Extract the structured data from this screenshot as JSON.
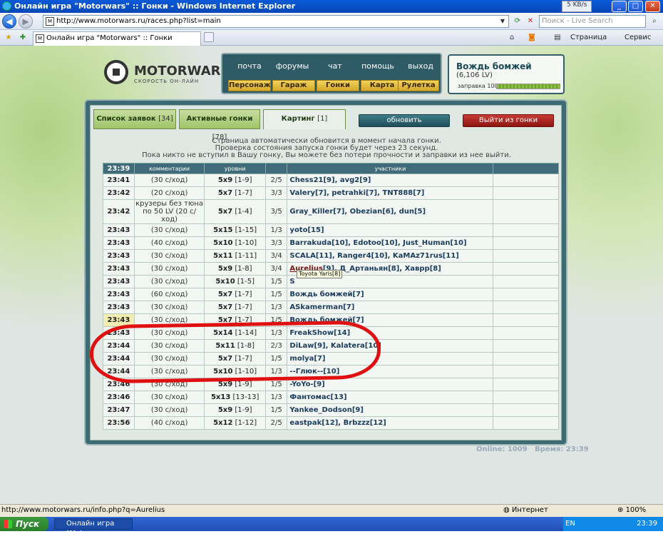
{
  "window": {
    "title": "Онлайн игра \"Motorwars\" :: Гонки - Windows Internet Explorer",
    "netspeed": "5 KB/s"
  },
  "browser": {
    "url": "http://www.motorwars.ru/races.php?list=main",
    "search_placeholder": "Поиск - Live Search",
    "tab_title": "Онлайн игра \"Motorwars\" :: Гонки",
    "page_menu": "Страница",
    "tools_menu": "Сервис"
  },
  "site": {
    "logo_name": "MOTORWARS.RU",
    "logo_sub": "СКОРОСТЬ ОН-ЛАЙН",
    "nav_top": [
      "почта",
      "форумы",
      "чат",
      "помощь",
      "выход"
    ],
    "nav_bottom": [
      "Персонаж",
      "Гараж",
      "Гонки",
      "Карта",
      "Рулетка"
    ]
  },
  "user": {
    "name": "Вождь бомжей",
    "lv": "(6,106 LV)",
    "fuel_label": "заправка 100%",
    "fuel_fraction": 1.0
  },
  "tabs": [
    {
      "label": "Список заявок",
      "count": "[34]"
    },
    {
      "label": "Активные гонки",
      "count": "[78]"
    },
    {
      "label": "Картинг",
      "count": "[1]"
    }
  ],
  "buttons": {
    "refresh": "обновить",
    "leave": "Выйти из гонки"
  },
  "notice": [
    "Страница автоматически обновится в момент начала гонки.",
    "Проверка состояния запуска гонки будет через 23 секунд.",
    "Пока никто не вступил в Вашу гонку, Вы можете без потери прочности и заправки из нее выйти."
  ],
  "table": {
    "time": "23:39",
    "col_comment": "комментарии",
    "col_levels": "уровни",
    "col_participants": "участники",
    "rows": [
      {
        "time": "23:41",
        "comment": "(30 с/ход)",
        "size": "5x9",
        "range": "[1-9]",
        "slots": "2/5",
        "participants": "Chess21[9], avg2[9]"
      },
      {
        "time": "23:42",
        "comment": "(20 с/ход)",
        "size": "5x7",
        "range": "[1-7]",
        "slots": "3/3",
        "participants": "Valery[7], petrahki[7], TNT888[7]"
      },
      {
        "time": "23:42",
        "comment": "крузеры без тюна по 50 LV (20 с/ход)",
        "size": "5x7",
        "range": "[1-4]",
        "slots": "3/5",
        "participants": "Gray_Killer[7], Obezian[6], dun[5]"
      },
      {
        "time": "23:43",
        "comment": "(30 с/ход)",
        "size": "5x15",
        "range": "[1-15]",
        "slots": "1/3",
        "participants": "yoto[15]"
      },
      {
        "time": "23:43",
        "comment": "(40 с/ход)",
        "size": "5x10",
        "range": "[1-10]",
        "slots": "3/3",
        "participants": "Barrakuda[10], Edotoo[10], Just_Human[10]"
      },
      {
        "time": "23:43",
        "comment": "(30 с/ход)",
        "size": "5x11",
        "range": "[1-11]",
        "slots": "3/4",
        "participants": "SCALA[11], Ranger4[10], KaMAz71rus[11]"
      },
      {
        "time": "23:43",
        "comment": "(30 с/ход)",
        "size": "5x9",
        "range": "[1-8]",
        "slots": "3/4",
        "lead": "Aurelius",
        "participants": "[9], Д_Артаньян[8], Хаврр[8]"
      },
      {
        "time": "23:43",
        "comment": "(30 с/ход)",
        "size": "5x10",
        "range": "[1-5]",
        "slots": "1/5",
        "participants": "S"
      },
      {
        "time": "23:43",
        "comment": "(60 с/ход)",
        "size": "5x7",
        "range": "[1-7]",
        "slots": "1/5",
        "participants": "Вождь бомжей[7]"
      },
      {
        "time": "23:43",
        "comment": "(30 с/ход)",
        "size": "5x7",
        "range": "[1-7]",
        "slots": "1/3",
        "participants": "ASkamerman[7]"
      },
      {
        "time": "23:43",
        "comment": "(30 с/ход)",
        "size": "5x7",
        "range": "[1-7]",
        "slots": "1/5",
        "participants": "Вождь бомжей[7]",
        "highlight": true
      },
      {
        "time": "23:43",
        "comment": "(30 с/ход)",
        "size": "5x14",
        "range": "[1-14]",
        "slots": "1/3",
        "participants": "FreakShow[14]"
      },
      {
        "time": "23:44",
        "comment": "(30 с/ход)",
        "size": "5x11",
        "range": "[1-8]",
        "slots": "2/3",
        "participants": "DiLaw[9], Kalatera[10]"
      },
      {
        "time": "23:44",
        "comment": "(30 с/ход)",
        "size": "5x7",
        "range": "[1-7]",
        "slots": "1/5",
        "participants": "molya[7]"
      },
      {
        "time": "23:44",
        "comment": "(30 с/ход)",
        "size": "5x10",
        "range": "[1-10]",
        "slots": "1/3",
        "participants": "--Глюк--[10]"
      },
      {
        "time": "23:46",
        "comment": "(30 с/ход)",
        "size": "5x9",
        "range": "[1-9]",
        "slots": "1/5",
        "participants": "-YoYo-[9]"
      },
      {
        "time": "23:46",
        "comment": "(30 с/ход)",
        "size": "5x13",
        "range": "[13-13]",
        "slots": "1/3",
        "participants": "Фантомас[13]"
      },
      {
        "time": "23:47",
        "comment": "(30 с/ход)",
        "size": "5x9",
        "range": "[1-9]",
        "slots": "1/5",
        "participants": "Yankee_Dodson[9]"
      },
      {
        "time": "23:56",
        "comment": "(40 с/ход)",
        "size": "5x12",
        "range": "[1-12]",
        "slots": "2/5",
        "participants": "eastpak[12], Brbzzz[12]"
      }
    ]
  },
  "tooltip": "Toyota Yaris[8]",
  "footer": {
    "online": "Online: 1009",
    "time": "Время: 23:39"
  },
  "status": {
    "link": "http://www.motorwars.ru/info.php?q=Aurelius",
    "zone": "Интернет",
    "zoom": "100%"
  },
  "taskbar": {
    "start": "Пуск",
    "task": "Онлайн игра \"Motor...",
    "lang": "EN",
    "clock": "23:39"
  }
}
